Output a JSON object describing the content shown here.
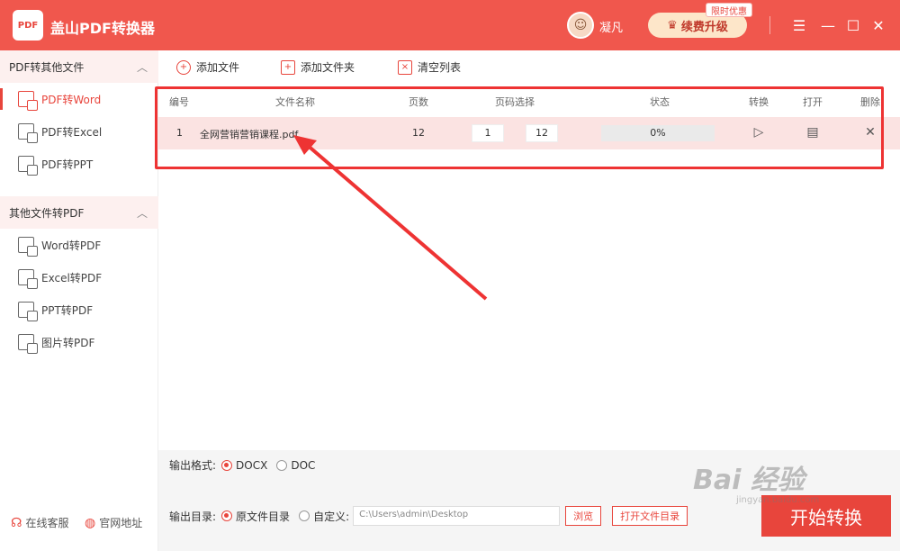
{
  "app": {
    "logo_text": "PDF",
    "title": "盖山PDF转换器"
  },
  "user": {
    "avatar_glyph": "☺",
    "name": "凝凡"
  },
  "promo": {
    "renew_label": "续费升级",
    "badge": "限时优惠"
  },
  "window": {
    "menu": "☰",
    "minimize": "—",
    "maximize": "☐",
    "close": "✕"
  },
  "sidebar": {
    "group1": {
      "label": "PDF转其他文件",
      "chev": "︿"
    },
    "group1_items": [
      {
        "label": "PDF转Word"
      },
      {
        "label": "PDF转Excel"
      },
      {
        "label": "PDF转PPT"
      }
    ],
    "group2": {
      "label": "其他文件转PDF",
      "chev": "︿"
    },
    "group2_items": [
      {
        "label": "Word转PDF"
      },
      {
        "label": "Excel转PDF"
      },
      {
        "label": "PPT转PDF"
      },
      {
        "label": "图片转PDF"
      }
    ],
    "footer_service": "在线客服",
    "footer_feedback": "官网地址"
  },
  "toolbar": {
    "add_file": "添加文件",
    "add_folder": "添加文件夹",
    "clear_list": "清空列表"
  },
  "table": {
    "headers": {
      "no": "编号",
      "name": "文件名称",
      "pages": "页数",
      "range": "页码选择",
      "status": "状态",
      "convert": "转换",
      "open": "打开",
      "delete": "删除"
    },
    "rows": [
      {
        "no": "1",
        "name": "全网营销营销课程.pdf",
        "pages": "12",
        "from": "1",
        "to": "12",
        "status": "0%"
      }
    ]
  },
  "output": {
    "format_label": "输出格式:",
    "format_options": [
      "DOCX",
      "DOC"
    ],
    "dir_label": "输出目录:",
    "dir_original": "原文件目录",
    "dir_custom": "自定义:",
    "dir_path": "C:\\Users\\admin\\Desktop",
    "browse": "浏览",
    "open_folder": "打开文件目录",
    "start": "开始转换"
  },
  "watermark": {
    "main": "Bai 经验",
    "sub": "jingyan.baidu.com"
  },
  "colors": {
    "brand": "#f0574d",
    "accent": "#e8453c",
    "row_highlight": "#fbe3e2"
  }
}
